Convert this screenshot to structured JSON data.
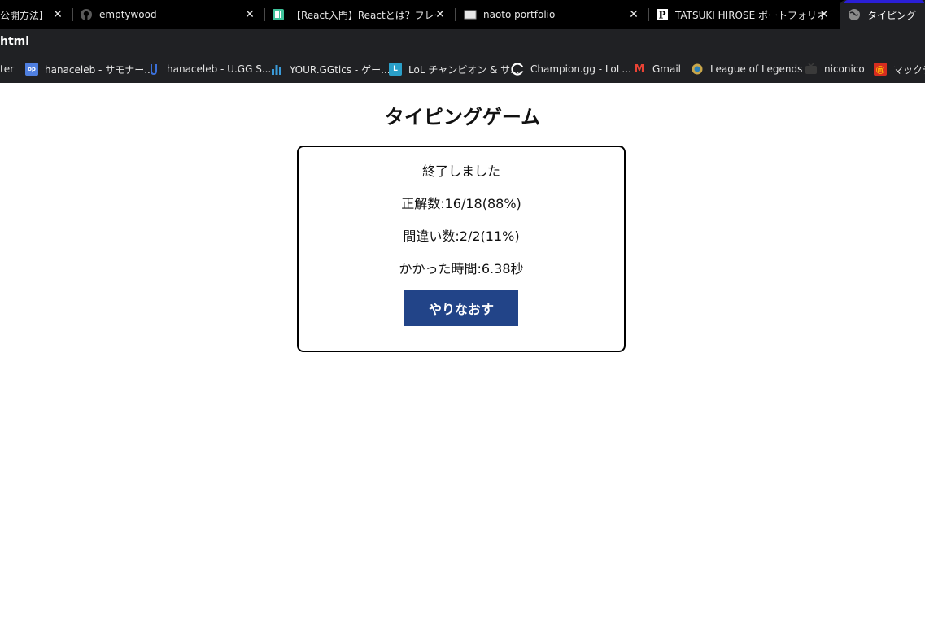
{
  "browser": {
    "tabs": [
      {
        "title": "【公開方法】",
        "close": "✕"
      },
      {
        "title": "emptywood",
        "close": "✕"
      },
      {
        "title": "【React入門】Reactとは？フレームワ",
        "close": "✕"
      },
      {
        "title": "naoto portfolio",
        "close": "✕"
      },
      {
        "title": "TATSUKI HIROSE ポートフォリオ",
        "close": "✕"
      },
      {
        "title": "タイピング"
      }
    ],
    "address": "html",
    "bookmarks": [
      {
        "label": "ter"
      },
      {
        "label": "hanaceleb - サモナー..."
      },
      {
        "label": "hanaceleb - U.GG S..."
      },
      {
        "label": "YOUR.GGtics - ゲー..."
      },
      {
        "label": "LoL チャンピオン & サ...",
        "icon_text": "L"
      },
      {
        "label": "Champion.gg - LoL..."
      },
      {
        "label": "Gmail",
        "icon_text": "M"
      },
      {
        "label": "League of Legends"
      },
      {
        "label": "niconico"
      },
      {
        "label": "マックデリ"
      }
    ]
  },
  "game": {
    "title": "タイピングゲーム",
    "finished": "終了しました",
    "correct": "正解数:16/18(88%)",
    "mistakes": "間違い数:2/2(11%)",
    "time": "かかった時間:6.38秒",
    "retry_label": "やりなおす"
  },
  "colors": {
    "retry_button": "#224488",
    "tab_accent": "#2a1fd6"
  }
}
